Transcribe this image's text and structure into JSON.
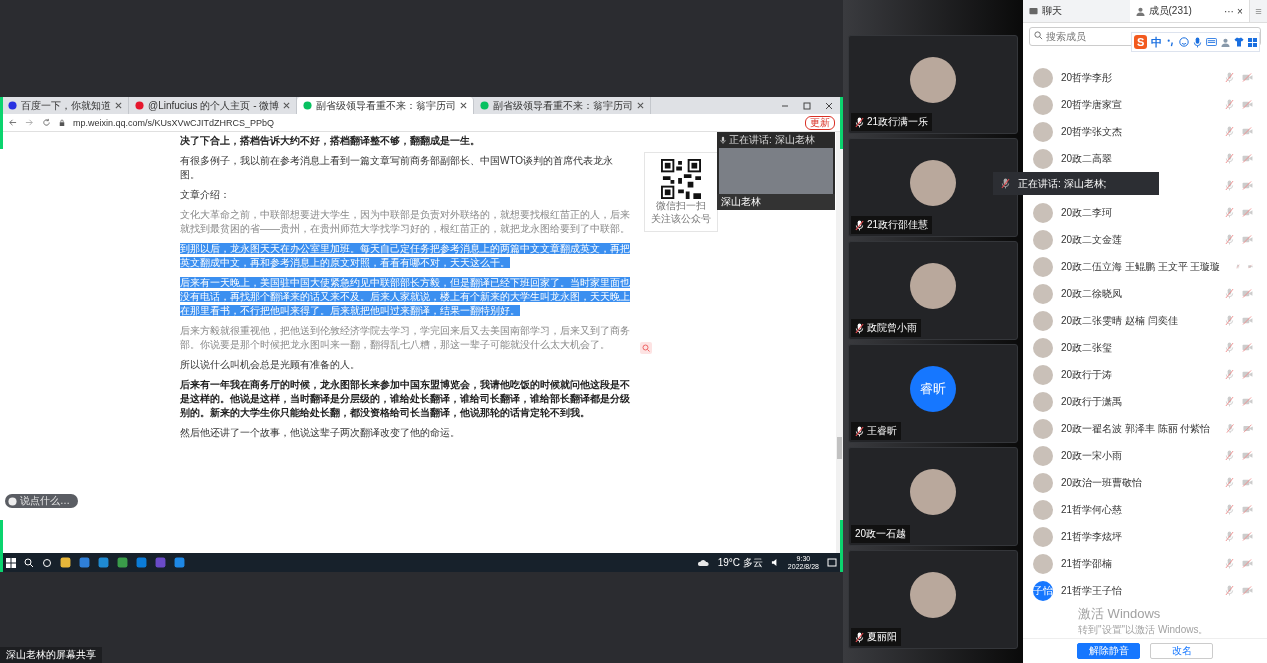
{
  "share": {
    "browser": {
      "tabs": [
        {
          "label": "百度一下，你就知道",
          "selected": false
        },
        {
          "label": "@Linfucius 的个人主页 - 微博",
          "selected": false
        },
        {
          "label": "副省级领导看重不来：翁宇历司",
          "selected": true
        },
        {
          "label": "副省级领导看重不来：翁宇历司",
          "selected": false
        }
      ],
      "url": "mp.weixin.qq.com/s/KUsXVwCJITdZHRCS_PPbQ",
      "update_button": "更新"
    },
    "article": {
      "paragraphs": [
        {
          "kind": "bold",
          "text": "决了下合上，搭档告诉大约不好，搭档翻译整不够，翻翻成是一生。"
        },
        {
          "kind": "normal",
          "text": "有很多例子，我以前在参考消息上看到一篇文章写前商务部副部长、中国WTO谈判的首席代表龙永图。"
        },
        {
          "kind": "normal",
          "text": "文章介绍："
        },
        {
          "kind": "muted",
          "text": "文化大革命之前，中联部想要进大学生，因为中联部是负责对外联络的，就想要找根红苗正的人，后来就找到最贫困的省——贵州，在贵州师范大学找学习好的，根红苗正的，就把龙永图给要到了中联部。"
        },
        {
          "kind": "selected",
          "text": "到那以后，龙永图天天在办公室里加班。每天自己定任务把参考消息上的两篇中文文章翻成英文，再把英文翻成中文，再和参考消息上的原文对照，看看有哪不对，天天这么干。"
        },
        {
          "kind": "selected",
          "text": "后来有一天晚上，美国驻中国大使紧急约见中联部部长方毅，但是翻译已经下班回家了。当时家里面也没有电话，再找那个翻译来的话又来不及。后来人家就说，楼上有个新来的大学生叫龙永图，天天晚上在那里看书，不行把他叫来得了。后来就把他叫过来翻译，结果一翻特别好。"
        },
        {
          "kind": "muted",
          "text": "后来方毅就很重视他，把他送到伦敦经济学院去学习，学完回来后又去美国南部学习，后来又到了商务部。你说要是那个时候把龙永图叫来一翻，翻得乱七八糟，那这一辈子可能就没什么太大机会了。"
        },
        {
          "kind": "normal",
          "text": "所以说什么叫机会总是光顾有准备的人。"
        },
        {
          "kind": "bold",
          "text": "后来有一年我在商务厅的时候，龙永图部长来参加中国东盟博览会，我请他吃饭的时候就问他这段是不是这样的。他说是这样，当时翻译是分层级的，谁给处长翻译，谁给司长翻译，谁给部长翻译都是分级别的。新来的大学生你只能给处长翻，都没资格给司长当翻译，他说那轮的话肯定轮不到我。"
        },
        {
          "kind": "normal",
          "text": "然后他还讲了一个故事，他说这辈子两次翻译改变了他的命运。"
        }
      ],
      "qr_caption": [
        "微信扫一扫",
        "关注该公众号"
      ]
    },
    "speaker_inset": {
      "status": "正在讲话: 深山老林",
      "name": "深山老林"
    },
    "chat_pill": "说点什么…",
    "taskbar": {
      "weather": "19°C 多云",
      "time": "9:30",
      "date": "2022/8/28"
    },
    "footer_label": "深山老林的屏幕共享"
  },
  "videos": [
    {
      "name": "21政行满一乐",
      "mic_muted": true
    },
    {
      "name": "21政行邵佳慧",
      "mic_muted": true
    },
    {
      "name": "政院曾小雨",
      "mic_muted": true
    },
    {
      "name": "王睿昕",
      "initials": "睿昕",
      "mic_muted": true
    },
    {
      "name": "20政一石越",
      "mic_muted": false
    },
    {
      "name": "夏丽阳",
      "mic_muted": true
    }
  ],
  "speaking_popup": "正在讲话: 深山老林;",
  "panel": {
    "tabs": [
      {
        "label": "聊天",
        "selected": false
      },
      {
        "label": "成员(231)",
        "selected": true
      }
    ],
    "header_actions": [
      "···",
      "×"
    ],
    "menu_glyph": "≡",
    "search": {
      "placeholder": "搜索成员"
    },
    "ime": {
      "logo": "S",
      "mode": "中"
    },
    "members": [
      {
        "name": "20哲学李彤",
        "mic_muted": true,
        "camera_off": true
      },
      {
        "name": "20哲学唐家宣",
        "mic_muted": true,
        "camera_off": true
      },
      {
        "name": "20哲学张文杰",
        "mic_muted": true,
        "camera_off": true
      },
      {
        "name": "20政二高翠",
        "mic_muted": true,
        "camera_off": true
      },
      {
        "mic_muted": true,
        "camera_off": true
      },
      {
        "name": "20政二李珂",
        "mic_muted": true,
        "camera_off": true
      },
      {
        "name": "20政二文金莲",
        "mic_muted": true,
        "camera_off": true
      },
      {
        "name": "20政二伍立海 王鲲鹏 王文平 王璇璇",
        "mic_muted": true,
        "camera_off": true
      },
      {
        "name": "20政二徐晓凤",
        "mic_muted": true,
        "camera_off": true
      },
      {
        "name": "20政二张雯晴 赵楠 闫奕佳",
        "mic_muted": true,
        "camera_off": true
      },
      {
        "name": "20政二张玺",
        "mic_muted": true,
        "camera_off": true
      },
      {
        "name": "20政行于涛",
        "mic_muted": true,
        "camera_off": true
      },
      {
        "name": "20政行于潇禹",
        "mic_muted": true,
        "camera_off": true
      },
      {
        "name": "20政一翟名波 郭泽丰 陈丽 付紫怡",
        "mic_muted": true,
        "camera_off": true
      },
      {
        "name": "20政一宋小雨",
        "mic_muted": true,
        "camera_off": true
      },
      {
        "name": "20政治一班曹敬怡",
        "mic_muted": true,
        "camera_off": true
      },
      {
        "name": "21哲学何心慈",
        "mic_muted": true,
        "camera_off": true
      },
      {
        "name": "21哲学李炫坪",
        "mic_muted": true,
        "camera_off": true
      },
      {
        "name": "21哲学邵楠",
        "mic_muted": true,
        "camera_off": true
      },
      {
        "name": "21哲学王子怡",
        "initials": "子怡",
        "mic_muted": true,
        "camera_off": true
      }
    ],
    "buttons": [
      {
        "label": "解除静音",
        "kind": "primary"
      },
      {
        "label": "改名",
        "kind": "secondary"
      }
    ]
  },
  "os_notice": {
    "title": "激活 Windows",
    "text": "转到\"设置\"以激活 Windows。"
  }
}
